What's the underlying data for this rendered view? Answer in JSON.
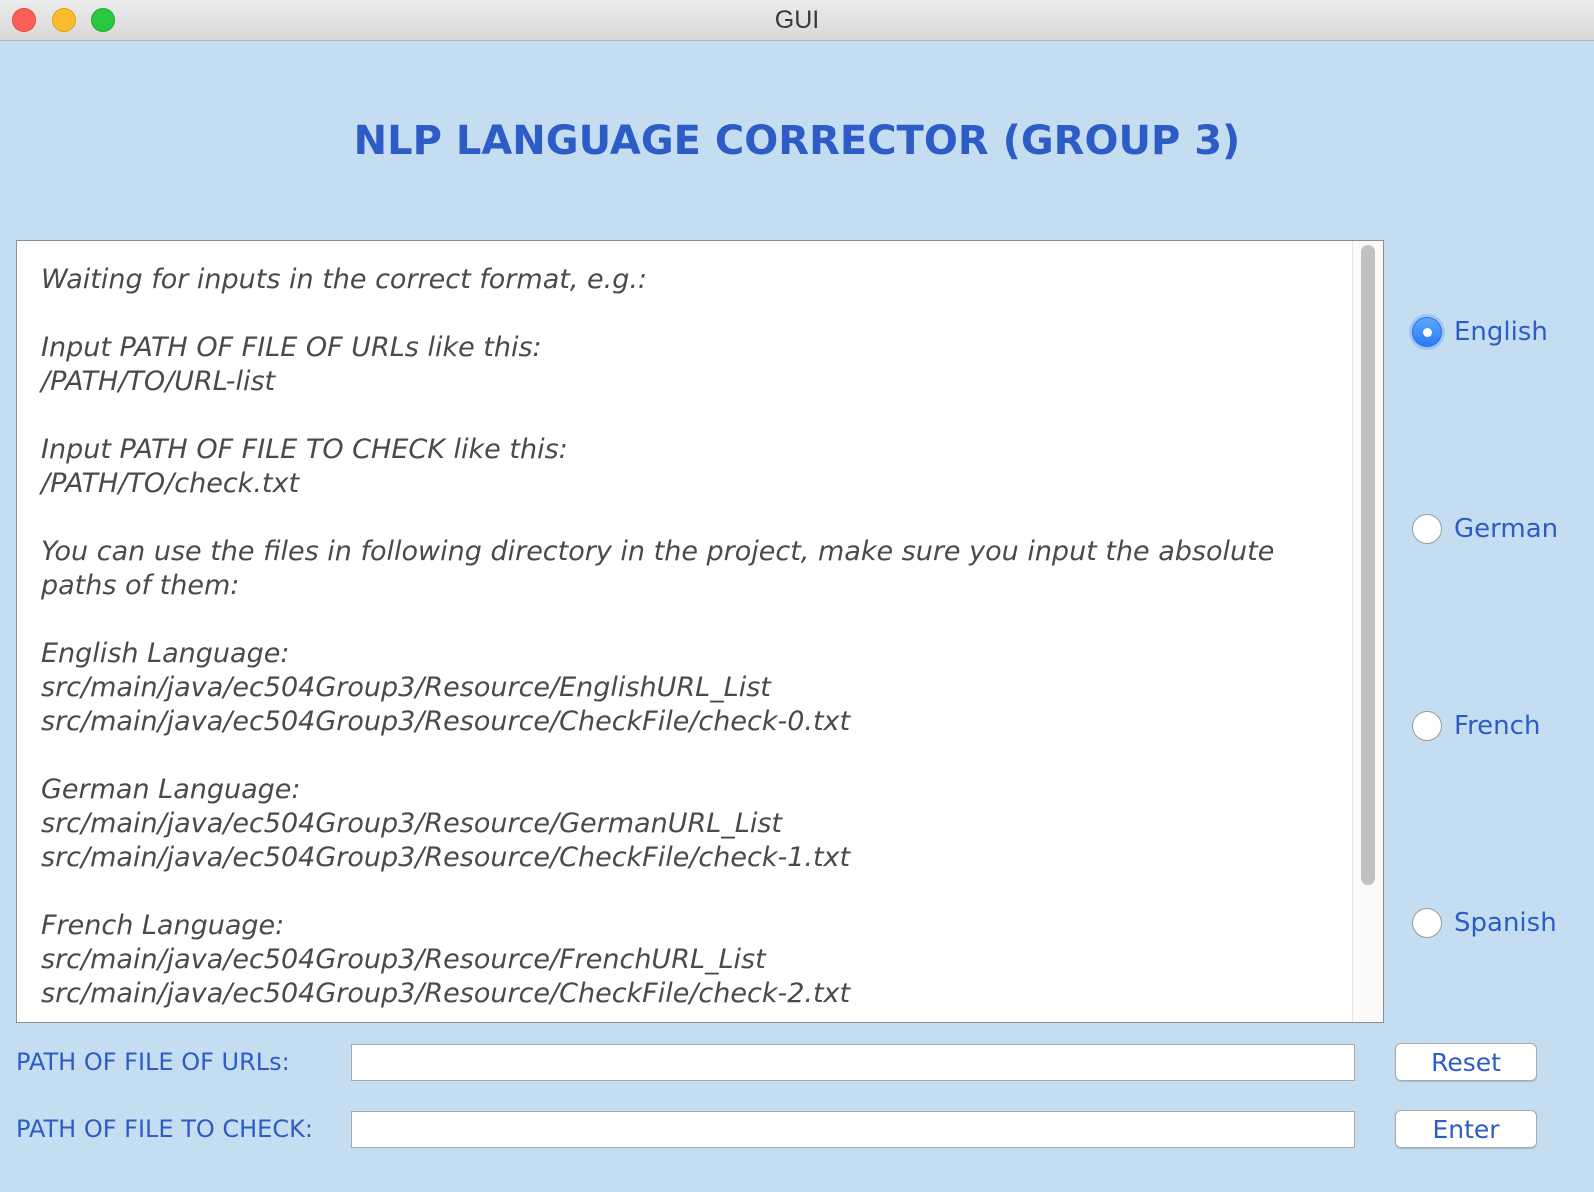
{
  "window": {
    "title": "GUI"
  },
  "app": {
    "heading": "NLP Language Corrector (GROUP 3)"
  },
  "output_text": {
    "lines": [
      "Waiting for inputs in the correct format, e.g.:",
      "",
      "Input PATH OF FILE OF URLs like this:",
      "/PATH/TO/URL-list",
      "",
      "Input PATH OF FILE TO CHECK like this:",
      "/PATH/TO/check.txt",
      "",
      "You can use the files in following directory in the project, make sure you input the absolute",
      "paths of them:",
      "",
      "English Language:",
      "src/main/java/ec504Group3/Resource/EnglishURL_List",
      "src/main/java/ec504Group3/Resource/CheckFile/check-0.txt",
      "",
      "German Language:",
      "src/main/java/ec504Group3/Resource/GermanURL_List",
      "src/main/java/ec504Group3/Resource/CheckFile/check-1.txt",
      "",
      "French Language:",
      "src/main/java/ec504Group3/Resource/FrenchURL_List",
      "src/main/java/ec504Group3/Resource/CheckFile/check-2.txt"
    ]
  },
  "languages": [
    {
      "label": "English",
      "selected": true
    },
    {
      "label": "German",
      "selected": false
    },
    {
      "label": "French",
      "selected": false
    },
    {
      "label": "Spanish",
      "selected": false
    }
  ],
  "form": {
    "urls_label": "PATH OF FILE OF URLs:",
    "urls_value": "",
    "check_label": "PATH OF FILE TO CHECK:",
    "check_value": ""
  },
  "buttons": {
    "reset": "Reset",
    "enter": "Enter"
  },
  "colors": {
    "background": "#c5ddf0",
    "accent": "#2e5cc7"
  }
}
